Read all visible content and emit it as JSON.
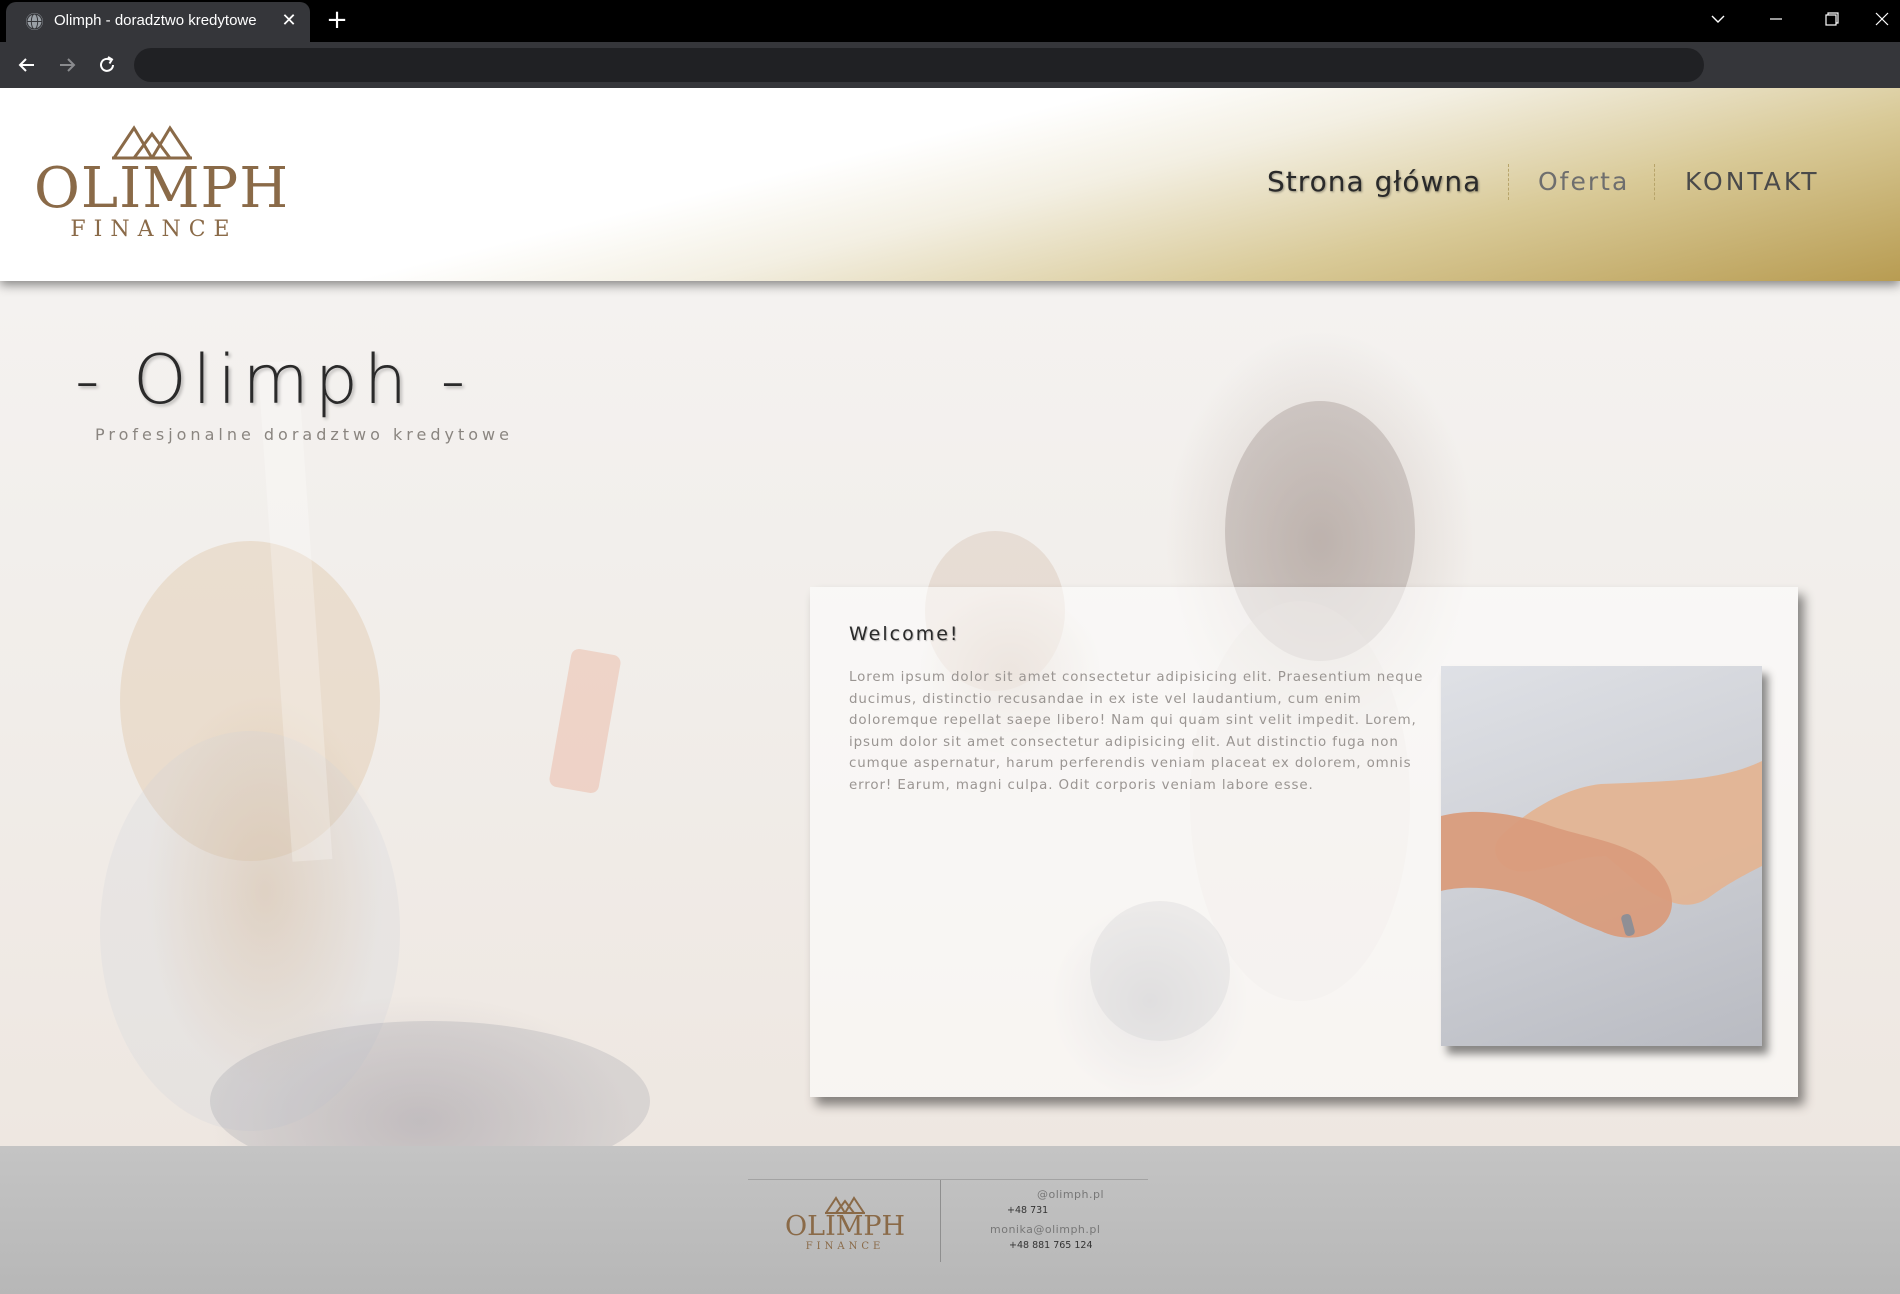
{
  "browser": {
    "tab_title": "Olimph - doradztwo kredytowe",
    "tab_close": "✕",
    "new_tab": "+",
    "address": ""
  },
  "header": {
    "logo": {
      "name": "OLIMPH",
      "sub": "FINANCE"
    },
    "nav": {
      "home": "Strona główna",
      "offer": "Oferta",
      "contact": "KONTAKT"
    }
  },
  "hero": {
    "title": "- Olimph -",
    "subtitle": "Profesjonalne doradztwo kredytowe"
  },
  "welcome": {
    "title": "Welcome!",
    "text": "Lorem ipsum dolor sit amet consectetur adipisicing elit. Praesentium neque ducimus, distinctio recusandae in ex iste vel laudantium, cum enim doloremque repellat saepe libero! Nam qui quam sint velit impedit. Lorem, ipsum dolor sit amet consectetur adipisicing elit. Aut distinctio fuga non cumque aspernatur, harum perferendis veniam placeat ex dolorem, omnis error! Earum, magni culpa. Odit corporis veniam labore esse."
  },
  "footer": {
    "logo": {
      "name": "OLIMPH",
      "sub": "FINANCE"
    },
    "email_1": "@olimph.pl",
    "phone_1": "+48 731",
    "email_2": "monika@olimph.pl",
    "phone_2": "+48 881 765 124"
  },
  "colors": {
    "brand_brown": "#8a6a48",
    "header_gold": "#b89c52",
    "footer_gray": "#bdbdbd"
  },
  "icons": [
    "globe-icon",
    "close-icon",
    "plus-icon",
    "chevron-down-icon",
    "minimize-icon",
    "restore-icon",
    "window-close-icon",
    "back-arrow-icon",
    "forward-arrow-icon",
    "reload-icon",
    "mountain-logo-icon"
  ]
}
